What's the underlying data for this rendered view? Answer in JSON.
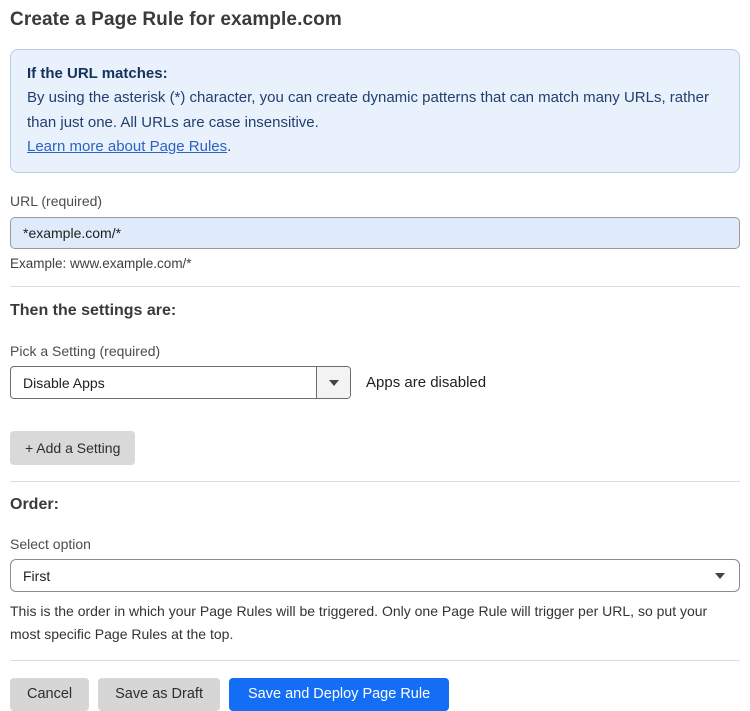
{
  "page": {
    "title": "Create a Page Rule for example.com"
  },
  "info_box": {
    "heading": "If the URL matches:",
    "body": "By using the asterisk (*) character, you can create dynamic patterns that can match many URLs, rather than just one. All URLs are case insensitive.",
    "link": "Learn more about Page Rules",
    "link_suffix": "."
  },
  "url_field": {
    "label": "URL (required)",
    "value": "*example.com/*",
    "example": "Example: www.example.com/*"
  },
  "settings": {
    "heading": "Then the settings are:",
    "pick_label": "Pick a Setting (required)",
    "selected_value": "Disable Apps",
    "status_text": "Apps are disabled",
    "add_button_label": "+ Add a Setting"
  },
  "order": {
    "heading": "Order:",
    "label": "Select option",
    "selected_value": "First",
    "help_text": "This is the order in which your Page Rules will be triggered. Only one Page Rule will trigger per URL, so put your most specific Page Rules at the top."
  },
  "footer": {
    "cancel_label": "Cancel",
    "save_draft_label": "Save as Draft",
    "save_deploy_label": "Save and Deploy Page Rule"
  },
  "colors": {
    "primary_blue": "#146ef5",
    "info_box_bg": "#e8f1fc",
    "info_box_border": "#b8cde9",
    "info_text": "#16325c",
    "link_blue": "#2c62c4",
    "url_input_bg": "#dfeafb",
    "gray_button_bg": "#d9d9d9"
  }
}
